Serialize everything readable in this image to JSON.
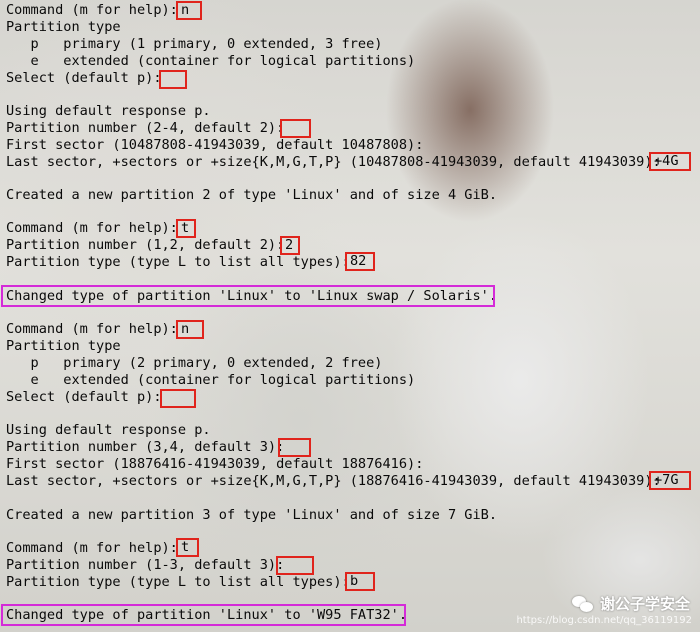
{
  "lines": [
    "Command (m for help): ",
    "Partition type",
    "   p   primary (1 primary, 0 extended, 3 free)",
    "   e   extended (container for logical partitions)",
    "Select (default p): ",
    "Using default response p.",
    "Partition number (2-4, default 2): ",
    "First sector (10487808-41943039, default 10487808):",
    "Last sector, +sectors or +size{K,M,G,T,P} (10487808-41943039, default 41943039): ",
    "Created a new partition 2 of type 'Linux' and of size 4 GiB.",
    "Command (m for help): ",
    "Partition number (1,2, default 2): ",
    "Partition type (type L to list all types): ",
    "Changed type of partition 'Linux' to 'Linux swap / Solaris'.",
    "Command (m for help): ",
    "Partition type",
    "   p   primary (2 primary, 0 extended, 2 free)",
    "   e   extended (container for logical partitions)",
    "Select (default p): ",
    "Using default response p.",
    "Partition number (3,4, default 3): ",
    "First sector (18876416-41943039, default 18876416):",
    "Last sector, +sectors or +size{K,M,G,T,P} (18876416-41943039, default 41943039): ",
    "Created a new partition 3 of type 'Linux' and of size 7 GiB.",
    "Command (m for help): ",
    "Partition number (1-3, default 3): ",
    "Partition type (type L to list all types): ",
    "Changed type of partition 'Linux' to 'W95 FAT32'."
  ],
  "inputs": [
    "n",
    "",
    "",
    "+4G",
    "t",
    "2",
    "82",
    "n",
    "",
    "",
    "+7G",
    "t",
    "",
    "b"
  ],
  "watermark": {
    "name": "谢公子学安全",
    "url": "https://blog.csdn.net/qq_36119192"
  },
  "colors": {
    "input_box": "#e0241c",
    "highlight_box": "#d42ad8",
    "text": "#0a0a0a"
  }
}
